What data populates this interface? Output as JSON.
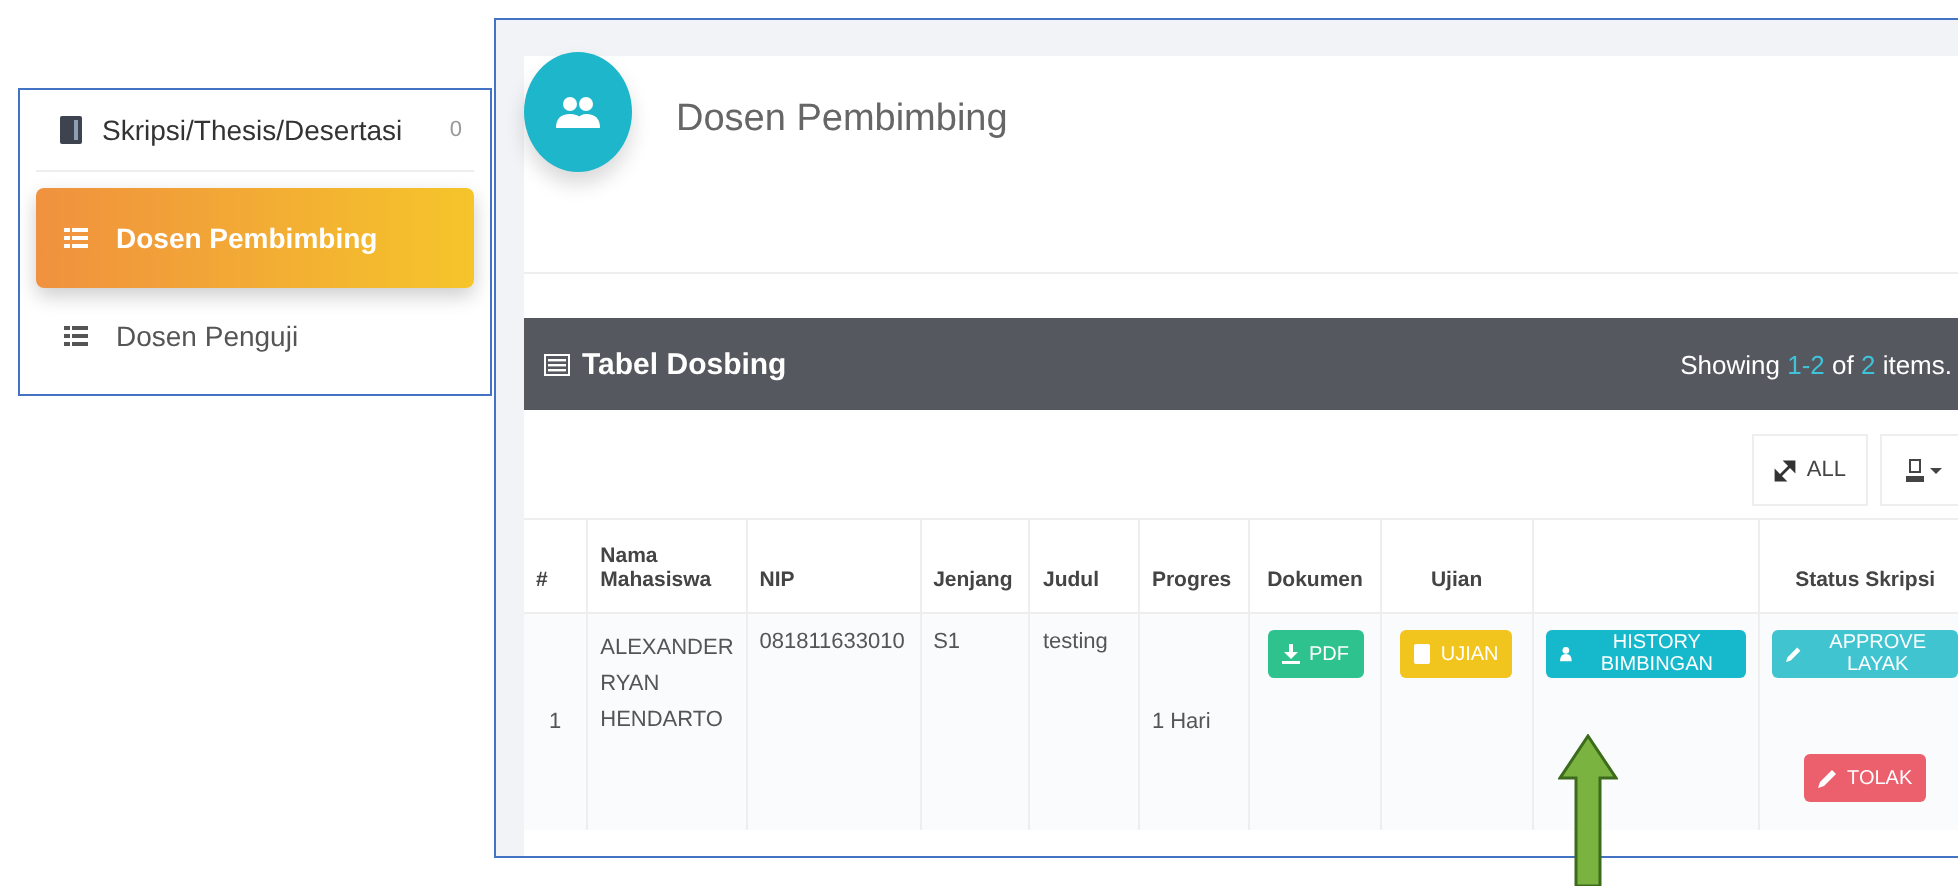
{
  "sidebar": {
    "section": {
      "label": "Skripsi/Thesis/Desertasi",
      "badge": "0"
    },
    "items": [
      {
        "label": "Dosen Pembimbing",
        "selected": true
      },
      {
        "label": "Dosen Penguji",
        "selected": false
      }
    ]
  },
  "page": {
    "title": "Dosen Pembimbing"
  },
  "table_panel": {
    "title": "Tabel Dosbing",
    "summary": {
      "prefix": "Showing",
      "range": "1-2",
      "of": "of",
      "total": "2",
      "suffix": "items."
    },
    "toolbar": {
      "all_label": "ALL"
    },
    "columns": [
      {
        "label": "#"
      },
      {
        "label": "Nama Mahasiswa"
      },
      {
        "label": "NIP"
      },
      {
        "label": "Jenjang"
      },
      {
        "label": "Judul"
      },
      {
        "label": "Progres"
      },
      {
        "label": "Dokumen"
      },
      {
        "label": "Ujian"
      },
      {},
      {
        "label": "Status Skripsi"
      }
    ],
    "rows": [
      {
        "number": "1",
        "name": "ALEXANDER RYAN HENDARTO",
        "nip": "081811633010",
        "jenjang": "S1",
        "judul": "testing",
        "progres": "1 Hari",
        "dokumen": "PDF",
        "ujian": "UJIAN",
        "history": "HISTORY BIMBINGAN",
        "approve": "APPROVE LAYAK",
        "reject": "TOLAK"
      }
    ]
  }
}
